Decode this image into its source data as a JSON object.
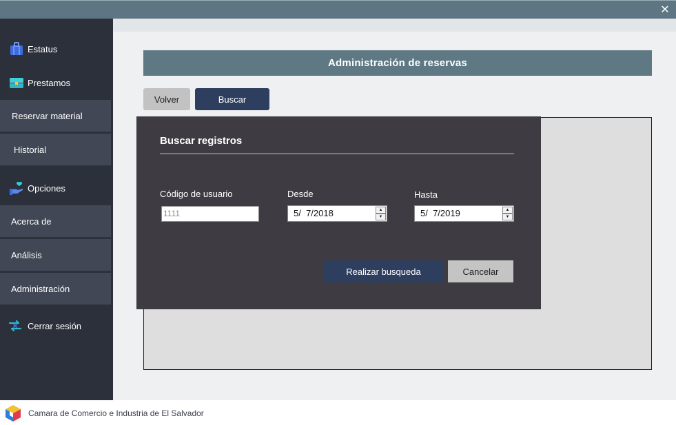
{
  "window": {
    "close_glyph": "✕"
  },
  "sidebar": {
    "status": {
      "label": "Estatus",
      "icon": "briefcase-icon"
    },
    "loans": {
      "label": "Prestamos",
      "icon": "toolbox-icon"
    },
    "loan_items": [
      "Reservar material",
      "Historial"
    ],
    "options": {
      "label": "Opciones",
      "icon": "hand-heart-icon"
    },
    "option_items": [
      "Acerca de",
      "Análisis",
      "Administración"
    ],
    "logout": {
      "label": "Cerrar sesión",
      "icon": "logout-icon"
    }
  },
  "main": {
    "header_title": "Administración de reservas",
    "back_label": "Volver",
    "search_label": "Buscar"
  },
  "dialog": {
    "title": "Buscar registros",
    "user_code_label": "Código de usuario",
    "user_code_value": "1111",
    "from_label": "Desde",
    "from_value": "5/  7/2018",
    "to_label": "Hasta",
    "to_value": "5/  7/2019",
    "submit_label": "Realizar busqueda",
    "cancel_label": "Cancelar"
  },
  "footer": {
    "organization": "Camara de Comercio e Industria de El Salvador"
  },
  "colors": {
    "accent": "#2e3e5e",
    "titlebar": "#5e7683",
    "sidebar": "#2c303b",
    "dialog": "#3e3c42"
  }
}
